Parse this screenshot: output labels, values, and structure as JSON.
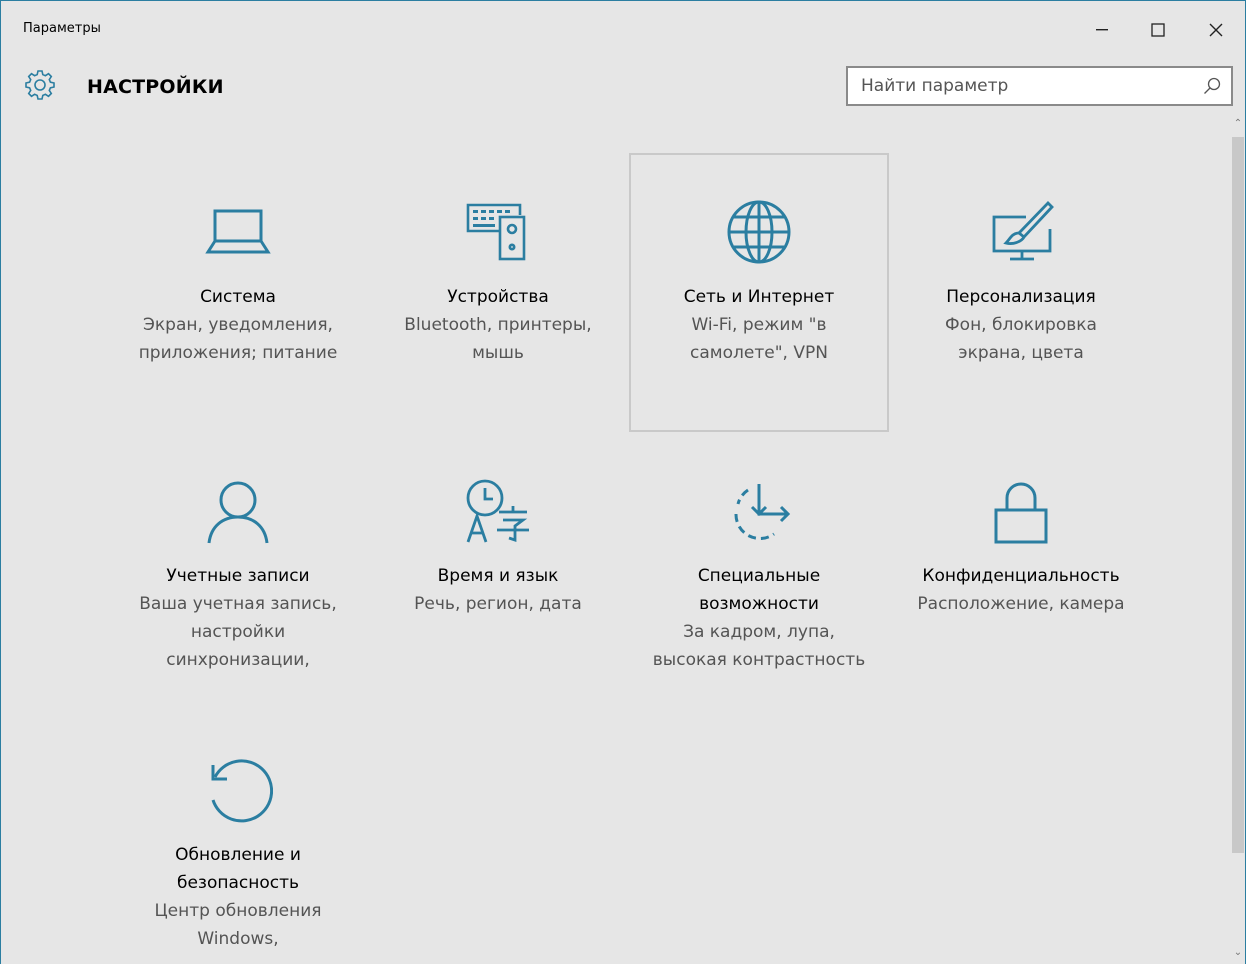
{
  "window": {
    "title": "Параметры",
    "controls": {
      "minimize": "–",
      "maximize": "☐",
      "close": "✕"
    }
  },
  "header": {
    "heading": "НАСТРОЙКИ",
    "icon": "gear-icon"
  },
  "search": {
    "placeholder": "Найти параметр",
    "value": "",
    "icon": "search-icon"
  },
  "accent_color": "#2b7ea1",
  "tiles": [
    {
      "title": "Система",
      "desc1": "Экран, уведомления,",
      "desc2": "приложения; питание",
      "desc3": "",
      "desc4": "",
      "icon": "laptop-icon"
    },
    {
      "title": "Устройства",
      "desc1": "Bluetooth, принтеры,",
      "desc2": "мышь",
      "desc3": "",
      "desc4": "",
      "icon": "devices-icon"
    },
    {
      "title": "Сеть и Интернет",
      "desc1": "Wi-Fi, режим \"в",
      "desc2": "самолете\", VPN",
      "desc3": "",
      "desc4": "",
      "icon": "globe-icon"
    },
    {
      "title": "Персонализация",
      "desc1": "Фон, блокировка",
      "desc2": "экрана, цвета",
      "desc3": "",
      "desc4": "",
      "icon": "personalization-icon"
    },
    {
      "title": "Учетные записи",
      "desc1": "Ваша учетная запись,",
      "desc2": "настройки",
      "desc3": "синхронизации,",
      "desc4": "",
      "icon": "person-icon"
    },
    {
      "title": "Время и язык",
      "desc1": "Речь, регион, дата",
      "desc2": "",
      "desc3": "",
      "desc4": "",
      "icon": "time-language-icon"
    },
    {
      "title1": "Специальные",
      "title2": "возможности",
      "desc1": "За кадром, лупа,",
      "desc2": "высокая контрастность",
      "desc3": "",
      "desc4": "",
      "icon": "ease-of-access-icon"
    },
    {
      "title": "Конфиденциальность",
      "desc1": "Расположение, камера",
      "desc2": "",
      "desc3": "",
      "desc4": "",
      "icon": "lock-icon"
    },
    {
      "title1": "Обновление и",
      "title2": "безопасность",
      "desc1": "Центр обновления",
      "desc2": "Windows,",
      "desc3": "",
      "desc4": "",
      "icon": "update-icon"
    }
  ]
}
